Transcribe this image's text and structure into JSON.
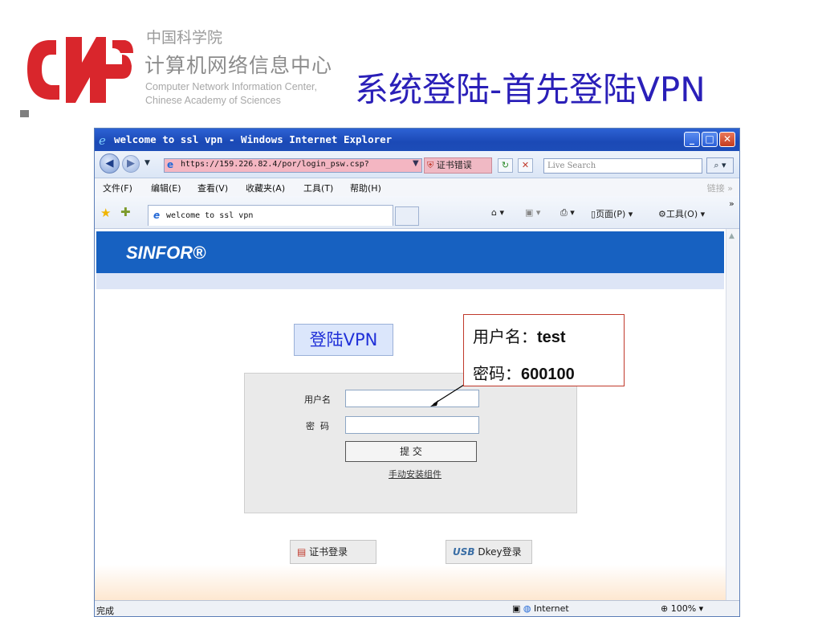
{
  "slide": {
    "org_cn_small": "中国科学院",
    "org_cn_big": "计算机网络信息中心",
    "org_en_line1": "Computer Network Information Center,",
    "org_en_line2": "Chinese Academy of Sciences",
    "title": "系统登陆-首先登陆VPN"
  },
  "browser": {
    "window_title": "welcome to ssl vpn - Windows Internet Explorer",
    "url": "https://159.226.82.4/por/login_psw.csp?",
    "cert_error": "证书错误",
    "search_placeholder": "Live Search",
    "menu": [
      "文件(F)",
      "编辑(E)",
      "查看(V)",
      "收藏夹(A)",
      "工具(T)",
      "帮助(H)"
    ],
    "menu_links": "链接",
    "tab_title": "welcome to ssl vpn",
    "cmd_page": "页面(P)",
    "cmd_tools": "工具(O)",
    "status_done": "完成",
    "status_zone": "Internet",
    "status_zoom": "100%"
  },
  "page": {
    "brand": "SINFOR®",
    "login_vpn_label": "登陆VPN",
    "username_label": "用户名",
    "password_label": "密  码",
    "submit_label": "提 交",
    "manual_install_link": "手动安装组件",
    "cert_login_button": "证书登录",
    "dkey_login_button": "Dkey登录"
  },
  "callout": {
    "username_prefix": "用户名：",
    "username_value": "test",
    "password_prefix": "密码：",
    "password_value": "600100"
  },
  "colors": {
    "title_blue": "#2a1fb8",
    "logo_red": "#d9262c",
    "banner_blue": "#1761c1",
    "callout_border": "#c0392b"
  }
}
